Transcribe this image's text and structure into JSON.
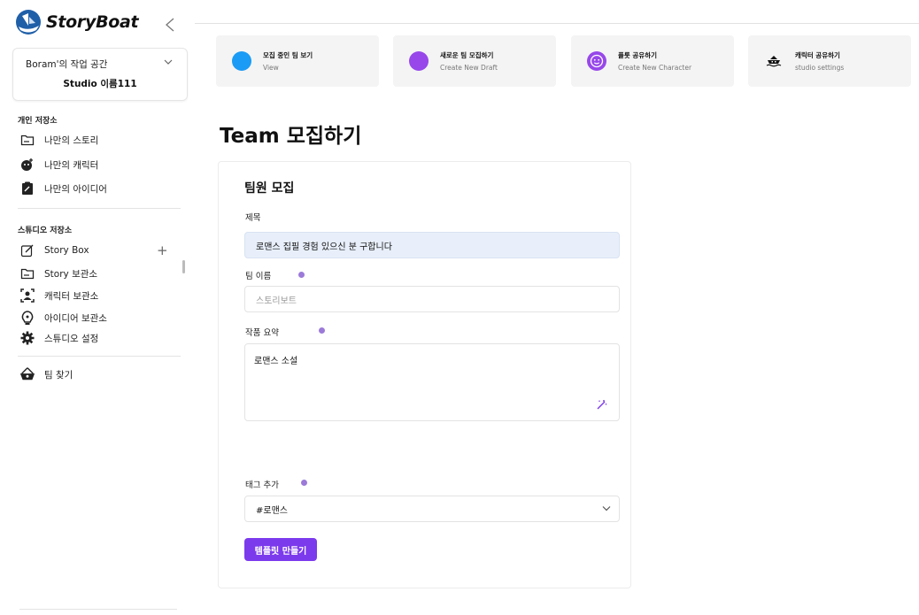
{
  "app": {
    "brand": "StoryBoat"
  },
  "workspace": {
    "title": "Boram'의 작업 공간",
    "studio": "Studio 이름111"
  },
  "sidebar": {
    "personal_label": "개인 저장소",
    "personal_items": [
      {
        "label": "나만의 스토리",
        "icon": "folder-icon"
      },
      {
        "label": "나만의 캐릭터",
        "icon": "character-add-icon"
      },
      {
        "label": "나만의 아이디어",
        "icon": "clipboard-icon"
      }
    ],
    "studio_label": "스튜디오 저장소",
    "studio_items": [
      {
        "label": "Story Box",
        "icon": "edit-icon"
      },
      {
        "label": "Story 보관소",
        "icon": "folder-icon"
      },
      {
        "label": "캐릭터 보관소",
        "icon": "user-frame-icon"
      },
      {
        "label": "아이디어 보관소",
        "icon": "bulb-icon"
      },
      {
        "label": "스튜디오 설정",
        "icon": "gear-icon"
      }
    ],
    "team_item": {
      "label": "팀 찾기",
      "icon": "basket-icon"
    }
  },
  "quick_cards": [
    {
      "title": "모집 중인 팀 보기",
      "sub": "View",
      "color": "#1a9bf5"
    },
    {
      "title": "새로운 팀 모집하기",
      "sub": "Create New Draft",
      "color": "#9747ea"
    },
    {
      "title": "플롯 공유하기",
      "sub": "Create New Character",
      "color": "#9747ea"
    },
    {
      "title": "캐릭터 공유하기",
      "sub": "studio settings",
      "color": "#111111"
    }
  ],
  "page": {
    "title": "Team 모집하기"
  },
  "form": {
    "heading": "팀원 모집",
    "title_label": "제목",
    "title_value": "로맨스 집필 경험 있으신 분 구합니다",
    "team_name_label": "팀 이름",
    "team_name_placeholder": "스토리보트",
    "summary_label": "작품 요약",
    "summary_value": "로맨스 소설",
    "tag_label": "태그 추가",
    "tag_value": "#로맨스",
    "submit_label": "템플릿 만들기"
  },
  "colors": {
    "accent": "#7c3aed",
    "input_fill": "#e8effa",
    "card_bg": "#f4f4f4"
  }
}
